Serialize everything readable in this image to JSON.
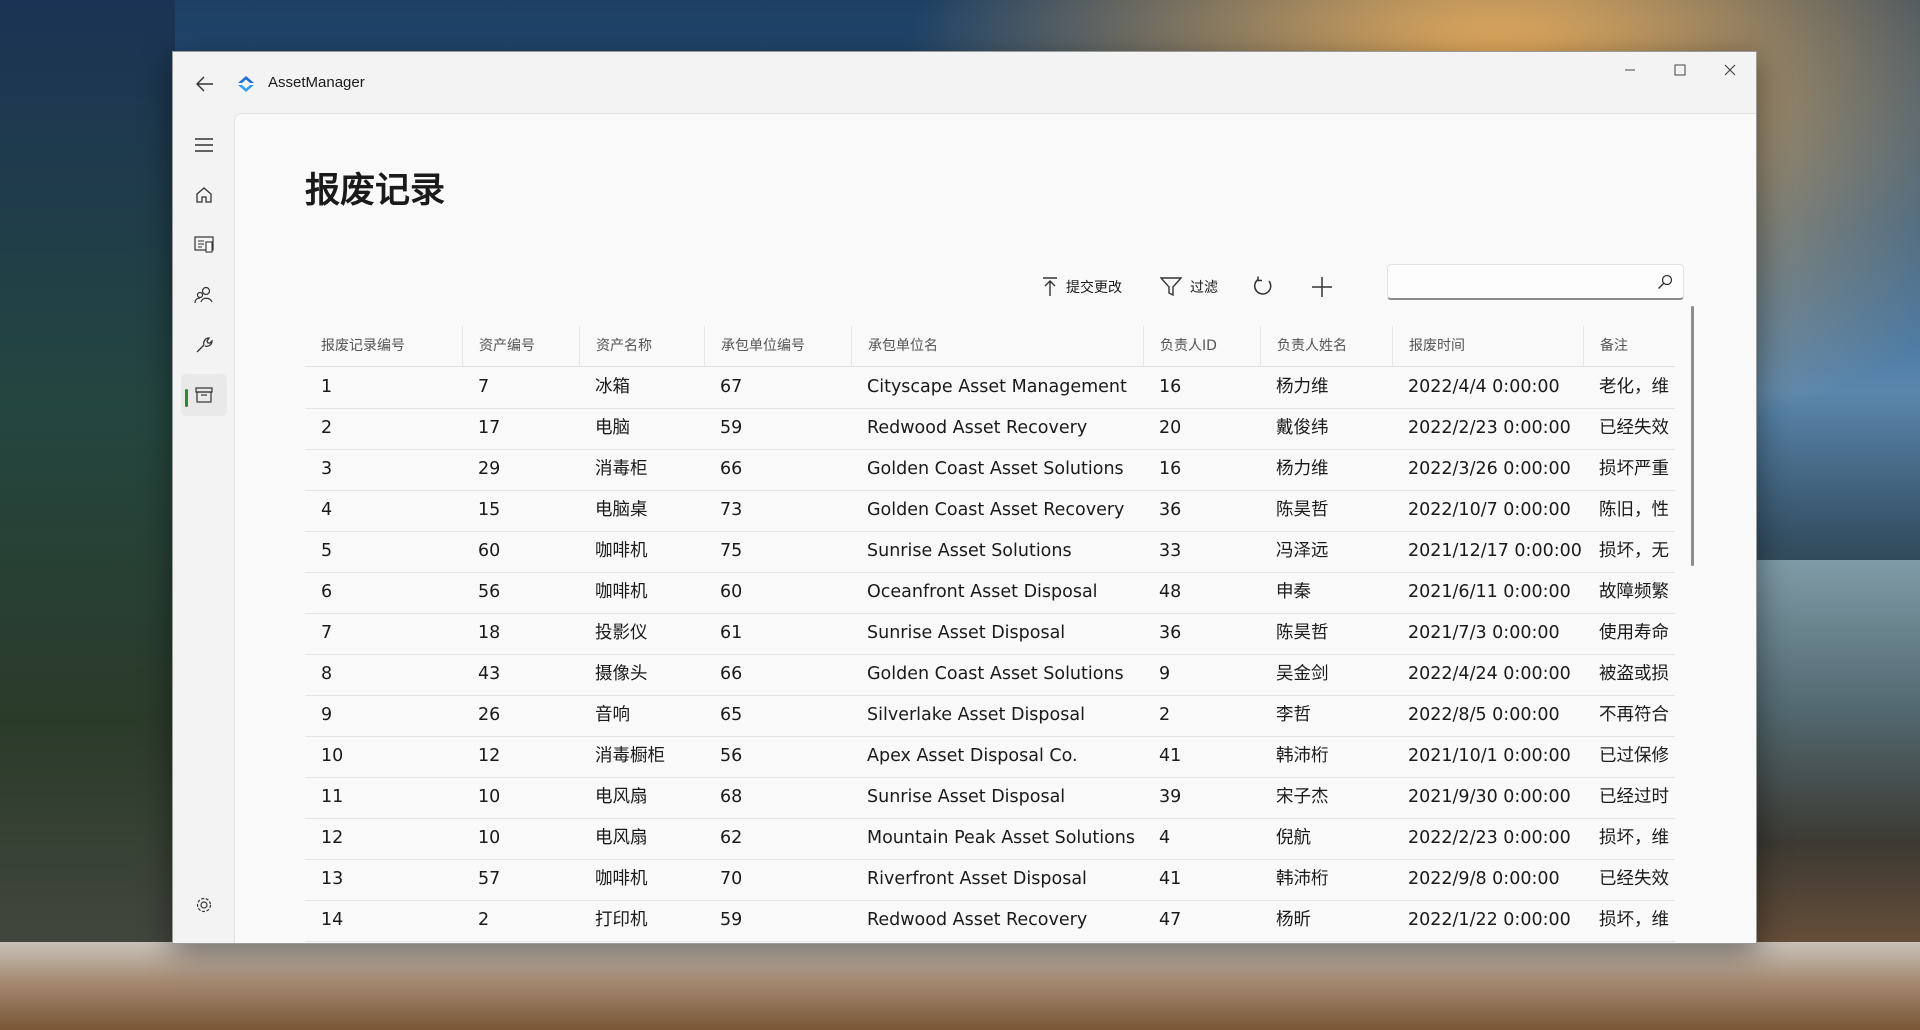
{
  "window": {
    "title": "AssetManager"
  },
  "page": {
    "title": "报废记录"
  },
  "toolbar": {
    "submit_label": "提交更改",
    "filter_label": "过滤",
    "search_value": ""
  },
  "nav": [
    "hamburger-icon",
    "home-icon",
    "asset-list-icon",
    "people-icon",
    "wrench-icon",
    "archive-icon",
    "settings-icon"
  ],
  "accent": "#2a8a3a",
  "table": {
    "headers": [
      "报废记录编号",
      "资产编号",
      "资产名称",
      "承包单位编号",
      "承包单位名",
      "负责人ID",
      "负责人姓名",
      "报废时间",
      "备注"
    ],
    "rows": [
      [
        "1",
        "7",
        "冰箱",
        "67",
        "Cityscape Asset Management",
        "16",
        "杨力维",
        "2022/4/4 0:00:00",
        "老化，维"
      ],
      [
        "2",
        "17",
        "电脑",
        "59",
        "Redwood Asset Recovery",
        "20",
        "戴俊纬",
        "2022/2/23 0:00:00",
        "已经失效"
      ],
      [
        "3",
        "29",
        "消毒柜",
        "66",
        "Golden Coast Asset Solutions",
        "16",
        "杨力维",
        "2022/3/26 0:00:00",
        "损坏严重"
      ],
      [
        "4",
        "15",
        "电脑桌",
        "73",
        "Golden Coast Asset Recovery",
        "36",
        "陈昊哲",
        "2022/10/7 0:00:00",
        "陈旧，性"
      ],
      [
        "5",
        "60",
        "咖啡机",
        "75",
        "Sunrise Asset Solutions",
        "33",
        "冯泽远",
        "2021/12/17 0:00:00",
        "损坏，无"
      ],
      [
        "6",
        "56",
        "咖啡机",
        "60",
        "Oceanfront Asset Disposal",
        "48",
        "申秦",
        "2021/6/11 0:00:00",
        "故障频繁"
      ],
      [
        "7",
        "18",
        "投影仪",
        "61",
        "Sunrise Asset Disposal",
        "36",
        "陈昊哲",
        "2021/7/3 0:00:00",
        "使用寿命"
      ],
      [
        "8",
        "43",
        "摄像头",
        "66",
        "Golden Coast Asset Solutions",
        "9",
        "吴金剑",
        "2022/4/24 0:00:00",
        "被盗或损"
      ],
      [
        "9",
        "26",
        "音响",
        "65",
        "Silverlake Asset Disposal",
        "2",
        "李哲",
        "2022/8/5 0:00:00",
        "不再符合"
      ],
      [
        "10",
        "12",
        "消毒橱柜",
        "56",
        "Apex Asset Disposal Co.",
        "41",
        "韩沛桁",
        "2021/10/1 0:00:00",
        "已过保修"
      ],
      [
        "11",
        "10",
        "电风扇",
        "68",
        "Sunrise Asset Disposal",
        "39",
        "宋子杰",
        "2021/9/30 0:00:00",
        "已经过时"
      ],
      [
        "12",
        "10",
        "电风扇",
        "62",
        "Mountain Peak Asset Solutions",
        "4",
        "倪航",
        "2022/2/23 0:00:00",
        "损坏，维"
      ],
      [
        "13",
        "57",
        "咖啡机",
        "70",
        "Riverfront Asset Disposal",
        "41",
        "韩沛桁",
        "2022/9/8 0:00:00",
        "已经失效"
      ],
      [
        "14",
        "2",
        "打印机",
        "59",
        "Redwood Asset Recovery",
        "47",
        "杨昕",
        "2022/1/22 0:00:00",
        "损坏，维"
      ]
    ]
  }
}
